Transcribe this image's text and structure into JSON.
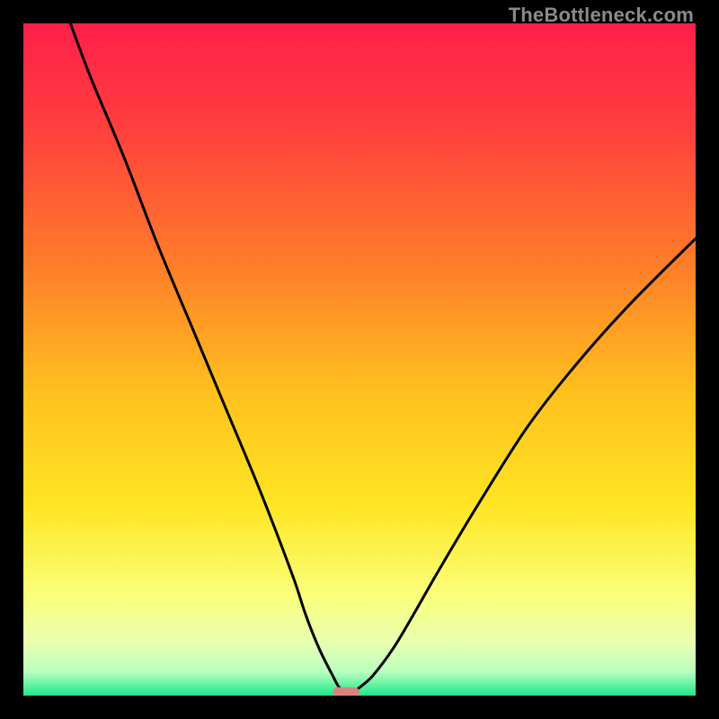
{
  "watermark": "TheBottleneck.com",
  "chart_data": {
    "type": "line",
    "title": "",
    "xlabel": "",
    "ylabel": "",
    "xlim": [
      0,
      100
    ],
    "ylim": [
      0,
      100
    ],
    "series": [
      {
        "name": "bottleneck-curve",
        "x": [
          7,
          10,
          15,
          20,
          25,
          30,
          35,
          40,
          42,
          44,
          46,
          47,
          48,
          49,
          50,
          52,
          55,
          58,
          62,
          68,
          75,
          82,
          90,
          100
        ],
        "values": [
          100,
          92,
          80,
          67,
          55,
          43,
          31,
          18,
          12,
          7,
          3,
          1.2,
          0.6,
          0.6,
          1.2,
          3,
          7,
          12,
          19,
          29,
          40,
          49,
          58,
          68
        ]
      }
    ],
    "marker": {
      "x_center": 48,
      "y": 0.5,
      "width": 4,
      "height": 1.5,
      "color": "#d9847f"
    },
    "gradient_stops": [
      {
        "offset": 0.0,
        "color": "#ff1f49"
      },
      {
        "offset": 0.15,
        "color": "#ff3e3e"
      },
      {
        "offset": 0.35,
        "color": "#ff7a2a"
      },
      {
        "offset": 0.55,
        "color": "#ffc11e"
      },
      {
        "offset": 0.72,
        "color": "#ffe625"
      },
      {
        "offset": 0.85,
        "color": "#faff7a"
      },
      {
        "offset": 0.92,
        "color": "#e9ffb0"
      },
      {
        "offset": 0.965,
        "color": "#b8ffc0"
      },
      {
        "offset": 1.0,
        "color": "#1de789"
      }
    ]
  }
}
